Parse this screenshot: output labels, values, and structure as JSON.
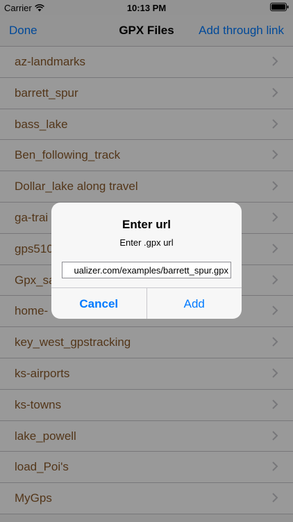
{
  "status_bar": {
    "carrier": "Carrier",
    "wifi_icon": "wifi-icon",
    "time": "10:13 PM",
    "battery_icon": "battery-icon"
  },
  "nav": {
    "left": "Done",
    "title": "GPX Files",
    "right": "Add through link"
  },
  "files": [
    {
      "label": "az-landmarks"
    },
    {
      "label": "barrett_spur"
    },
    {
      "label": "bass_lake"
    },
    {
      "label": "Ben_following_track"
    },
    {
      "label": "Dollar_lake along travel"
    },
    {
      "label": "ga-trai"
    },
    {
      "label": "gps510"
    },
    {
      "label": "Gpx_sa"
    },
    {
      "label": "home-"
    },
    {
      "label": "key_west_gpstracking"
    },
    {
      "label": "ks-airports"
    },
    {
      "label": "ks-towns"
    },
    {
      "label": "lake_powell"
    },
    {
      "label": "load_Poi's"
    },
    {
      "label": "MyGps"
    }
  ],
  "row_chevron_icon": "chevron-right-icon",
  "alert": {
    "title": "Enter url",
    "message": "Enter .gpx url",
    "input_value": "ualizer.com/examples/barrett_spur.gpx",
    "cancel": "Cancel",
    "add": "Add"
  },
  "colors": {
    "accent": "#007aff",
    "row_text": "#8b5a2b"
  }
}
